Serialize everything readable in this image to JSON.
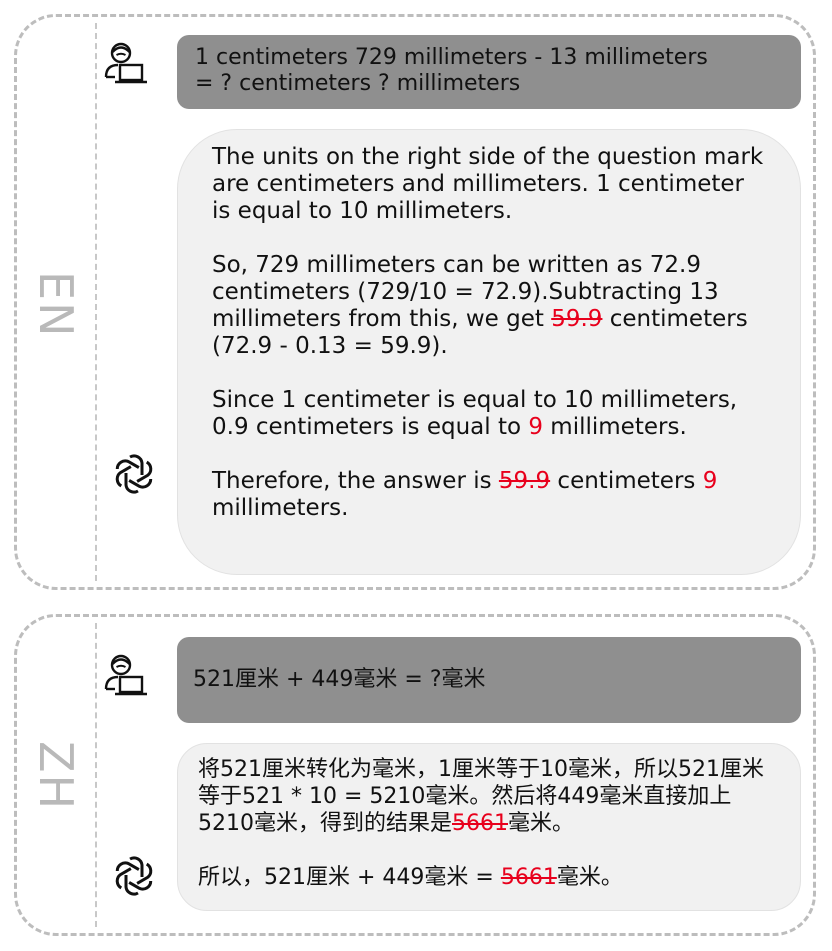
{
  "en": {
    "label": "EN",
    "question_line1": "1 centimeters 729 millimeters  - 13 millimeters",
    "question_line2": "= ? centimeters ? millimeters",
    "answer": {
      "p1": "The units on the right side of the question mark are centimeters and millimeters. 1 centimeter is equal to 10 millimeters.",
      "p2_a": "So, 729 millimeters can be written as 72.9 centimeters (729/10 = 72.9).Subtracting 13 millimeters from this, we get ",
      "p2_wrong": "59.9",
      "p2_b": " centimeters (72.9 - 0.13 = 59.9).",
      "p3_a": "Since 1 centimeter is equal to 10 millimeters, 0.9 centimeters is equal to ",
      "p3_wrong": "9",
      "p3_b": " millimeters.",
      "p4_a": "Therefore, the answer is ",
      "p4_wrong1": "59.9",
      "p4_b": " centimeters ",
      "p4_wrong2": "9",
      "p4_c": " millimeters."
    }
  },
  "zh": {
    "label": "ZH",
    "question": "521厘米 + 449毫米 = ?毫米",
    "answer": {
      "p1_a": "将521厘米转化为毫米，1厘米等于10毫米，所以521厘米等于521 * 10 = 5210毫米。然后将449毫米直接加上5210毫米，得到的结果是",
      "p1_wrong": "5661",
      "p1_b": "毫米。",
      "p2_a": "所以，521厘米 + 449毫米 = ",
      "p2_wrong": "5661",
      "p2_b": "毫米。"
    }
  },
  "icons": {
    "user": "user-laptop-icon",
    "bot": "openai-logo-icon"
  },
  "colors": {
    "error": "#e8001c",
    "user_bubble": "#8f8f8f",
    "bot_bubble": "#f1f1f1",
    "border": "#bdbdbd"
  }
}
